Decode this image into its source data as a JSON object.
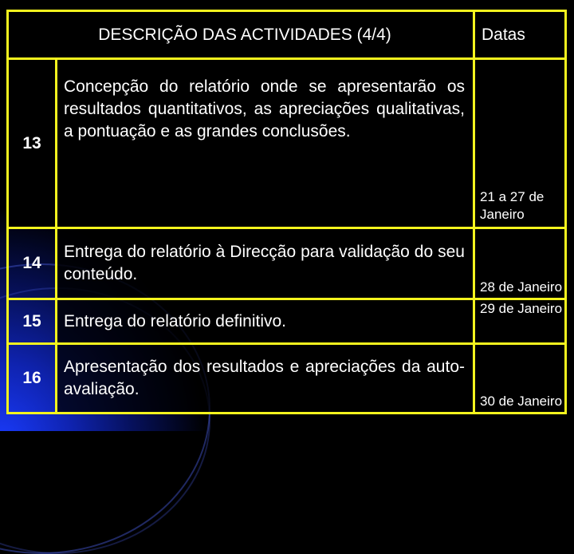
{
  "slide": {
    "header": {
      "description_title": "DESCRIÇÃO DAS ACTIVIDADES (4/4)",
      "dates_title": "Datas"
    },
    "rows": [
      {
        "number": "13",
        "description": "Concepção do relatório onde se apresentarão os resultados quantitativos, as apreciações qualitativas, a pontuação e as grandes conclusões.",
        "date": "21 a 27 de Janeiro"
      },
      {
        "number": "14",
        "description": "Entrega do relatório à Direcção para validação do seu conteúdo.",
        "date": "28 de Janeiro"
      },
      {
        "number": "15",
        "description": "Entrega do relatório definitivo.",
        "date": "29 de Janeiro"
      },
      {
        "number": "16",
        "description": "Apresentação dos resultados e apreciações da auto-avaliação.",
        "date": "30 de Janeiro"
      }
    ]
  },
  "colors": {
    "border": "#f4f41e",
    "text": "#ffffff",
    "background": "#000000",
    "accent_gradient": "#1a3cff"
  }
}
